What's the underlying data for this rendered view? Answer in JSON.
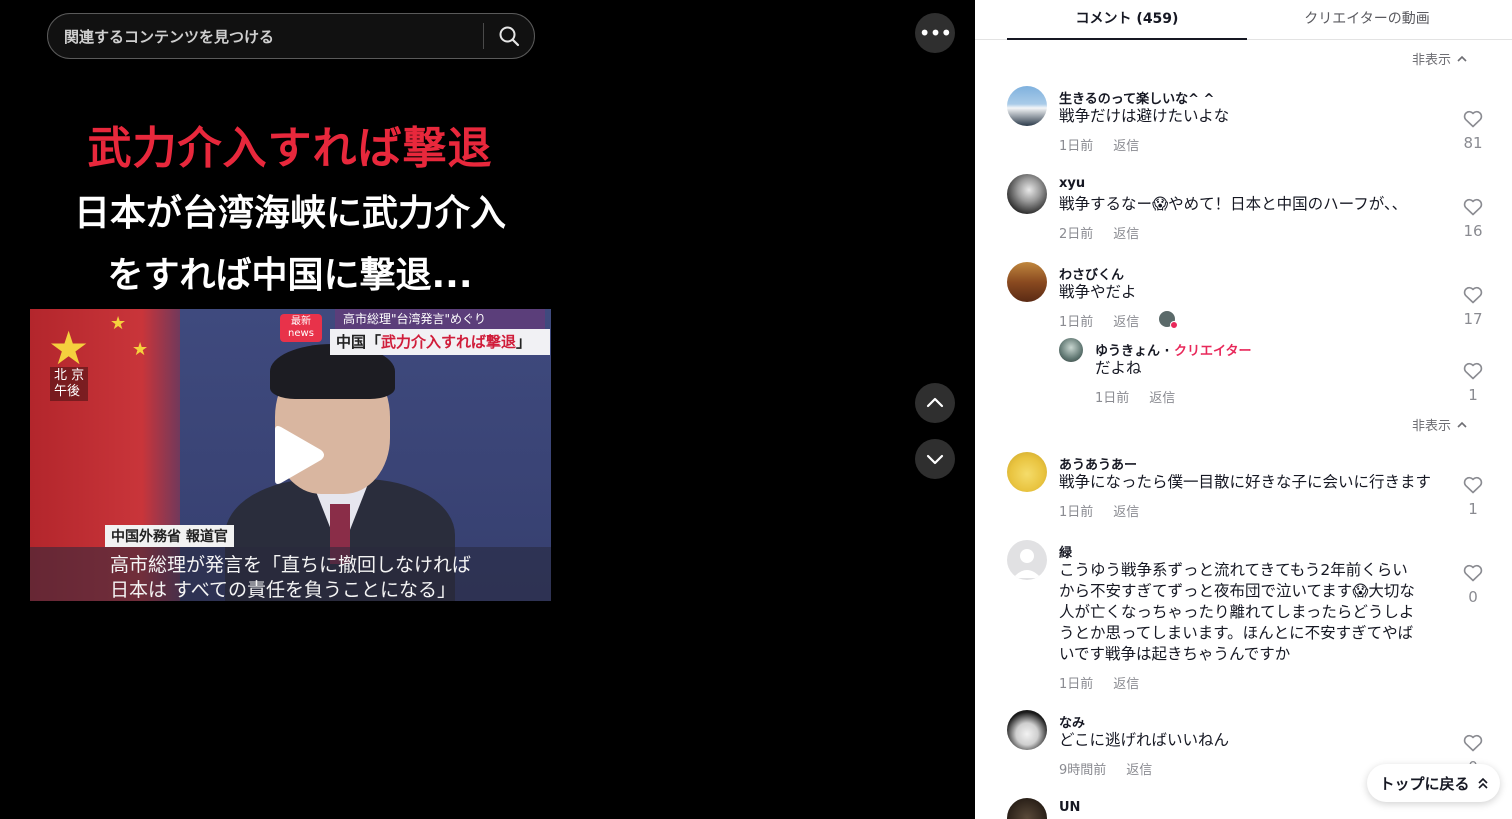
{
  "search": {
    "placeholder": "関連するコンテンツを見つける"
  },
  "video": {
    "overlay_red": "武力介入すれば撃退",
    "overlay_line1": "日本が台湾海峡に武力介入",
    "overlay_line2": "をすれば中国に撃退...",
    "thumbnail": {
      "city": "北 京",
      "time": "午後",
      "news_logo_top": "最新",
      "news_logo_bottom": "news",
      "banner_top": "高市総理\"台湾発言\"めぐり",
      "banner_prefix": "中国「",
      "banner_highlight": "武力介入すれば撃退",
      "banner_suffix": "」",
      "role_label": "中国外務省 報道官",
      "caption_line1": "高市総理が発言を「直ちに撤回しなければ",
      "caption_line2": "日本は すべての責任を負うことになる」"
    }
  },
  "tabs": {
    "comments": "コメント (459)",
    "creator": "クリエイターの動画"
  },
  "hide_label": "非表示",
  "reply_label": "返信",
  "comments": [
    {
      "name": "生きるのって楽しいな^ ^",
      "text": "戦争だけは避けたいよな",
      "time": "1日前",
      "likes": "81"
    },
    {
      "name": "xyu",
      "text": "戦争するなー😱やめて！日本と中国のハーフが、、",
      "time": "2日前",
      "likes": "16"
    },
    {
      "name": "わさびくん",
      "text": "戦争やだよ",
      "time": "1日前",
      "likes": "17"
    },
    {
      "name": "あうあうあー",
      "text": "戦争になったら僕一目散に好きな子に会いに行きます",
      "time": "1日前",
      "likes": "1"
    },
    {
      "name": "緑",
      "text": "こうゆう戦争系ずっと流れてきてもう2年前くらいから不安すぎてずっと夜布団で泣いてます😱大切な人が亡くなっちゃったり離れてしまったらどうしようとか思ってしまいます。ほんとに不安すぎてやばいです戦争は起きちゃうんですか",
      "time": "1日前",
      "likes": "0"
    },
    {
      "name": "なみ",
      "text": "どこに逃げればいいねん",
      "time": "9時間前",
      "likes": "0"
    },
    {
      "name": "UN"
    }
  ],
  "reply": {
    "name": "ゆうきょん",
    "creator_label": "クリエイター",
    "text": "だよね",
    "time": "1日前",
    "likes": "1"
  },
  "back_to_top": "トップに戻る"
}
